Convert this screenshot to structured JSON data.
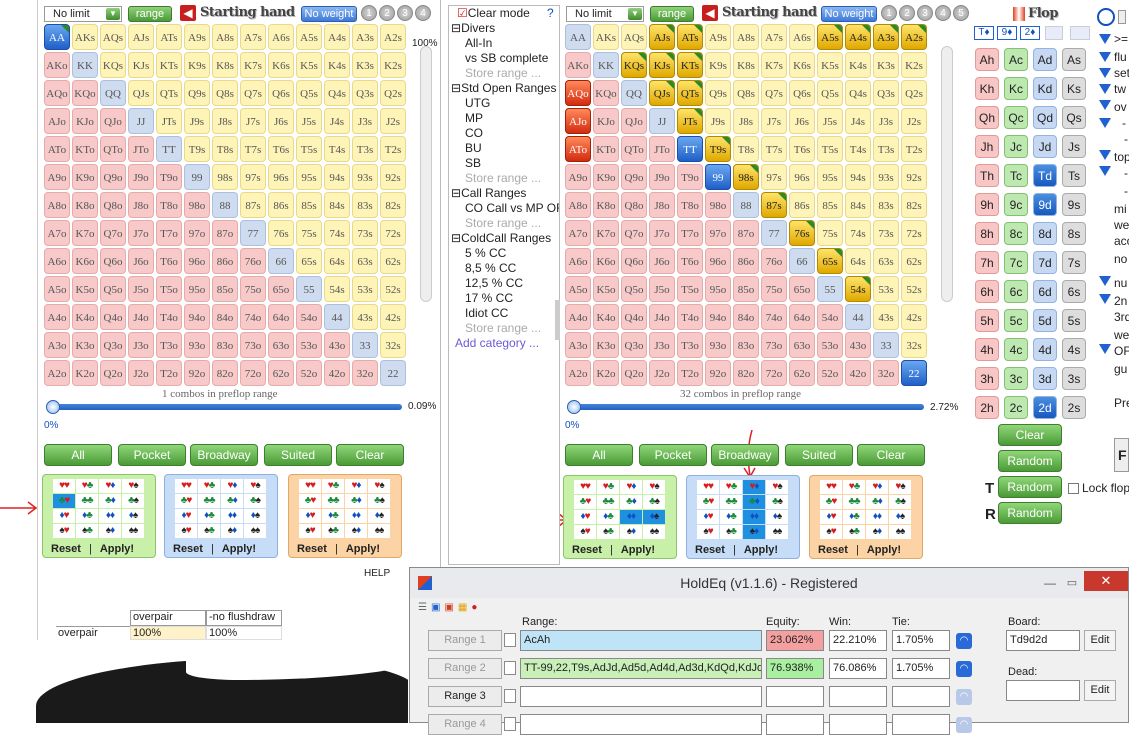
{
  "left_panel": {
    "limit_select": "No limit",
    "range_btn": "range",
    "title": "Starting hand",
    "weight_btn": "No weight",
    "slots": [
      "1",
      "2",
      "3",
      "4"
    ],
    "pct_top": "100%",
    "pct_mid": "0.09%",
    "pct_low": "0%",
    "combos_text": "1 combos in preflop range",
    "buttons": [
      "All",
      "Pocket",
      "Broadway",
      "Suited",
      "Clear"
    ],
    "help": "HELP",
    "selected_hands": [
      "AA"
    ],
    "selected_with_tri": [
      "AA"
    ]
  },
  "tree": {
    "header": "Clear mode",
    "help_q": "?",
    "items": [
      {
        "kind": "cat",
        "text": "Divers"
      },
      {
        "kind": "it",
        "text": "All-In"
      },
      {
        "kind": "it",
        "text": "vs SB complete"
      },
      {
        "kind": "store",
        "text": "Store range ..."
      },
      {
        "kind": "cat",
        "text": "Std Open Ranges"
      },
      {
        "kind": "it",
        "text": "UTG"
      },
      {
        "kind": "it",
        "text": "MP"
      },
      {
        "kind": "it",
        "text": "CO"
      },
      {
        "kind": "it",
        "text": "BU"
      },
      {
        "kind": "it",
        "text": "SB"
      },
      {
        "kind": "store",
        "text": "Store range ..."
      },
      {
        "kind": "cat",
        "text": "Call Ranges"
      },
      {
        "kind": "it",
        "text": "CO Call vs MP OR"
      },
      {
        "kind": "store",
        "text": "Store range ..."
      },
      {
        "kind": "cat",
        "text": "ColdCall Ranges"
      },
      {
        "kind": "it",
        "text": "5 % CC"
      },
      {
        "kind": "it",
        "text": "8,5 % CC"
      },
      {
        "kind": "it",
        "text": "12,5 % CC"
      },
      {
        "kind": "it",
        "text": "17 % CC"
      },
      {
        "kind": "it",
        "text": "Idiot CC"
      },
      {
        "kind": "store",
        "text": "Store range ..."
      },
      {
        "kind": "add",
        "text": "Add category ..."
      }
    ]
  },
  "mid_panel": {
    "limit_select": "No limit",
    "range_btn": "range",
    "title": "Starting hand",
    "weight_btn": "No weight",
    "slots": [
      "1",
      "2",
      "3",
      "4",
      "5"
    ],
    "pct_mid": "2.72%",
    "pct_low": "0%",
    "combos_text": "32 combos in preflop range",
    "buttons": [
      "All",
      "Pocket",
      "Broadway",
      "Suited",
      "Clear"
    ],
    "selected_hands": [
      "AQo",
      "AJo",
      "ATo",
      "AJs",
      "ATs",
      "KQs",
      "KJs",
      "KTs",
      "QJs",
      "QTs",
      "JTs",
      "A5s",
      "A4s",
      "A3s",
      "A2s",
      "TT",
      "T9s",
      "99",
      "98s",
      "87s",
      "76s",
      "65s",
      "54s",
      "22"
    ],
    "selected_with_tri": [
      "A5s",
      "A4s",
      "A3s",
      "A2s",
      "AJs",
      "ATs",
      "KQs",
      "KJs",
      "KTs",
      "QJs",
      "QTs",
      "JTs",
      "98s",
      "87s",
      "76s",
      "65s",
      "54s",
      "T9s"
    ]
  },
  "flop": {
    "title": "Flop",
    "board_cards": [
      "T♦",
      "9♦",
      "2♦"
    ],
    "ranks": [
      "A",
      "K",
      "Q",
      "J",
      "T",
      "9",
      "8",
      "7",
      "6",
      "5",
      "4",
      "3",
      "2"
    ],
    "selected": [
      "Td",
      "9d",
      "2d"
    ],
    "buttons": [
      "Clear",
      "Random",
      "Random",
      "Random"
    ],
    "t_label": "T",
    "r_label": "R",
    "lock_label": "Lock flop"
  },
  "right_notes": [
    ">=",
    "flu",
    "set",
    "tw",
    "ov",
    "-",
    "-",
    "top",
    "-",
    "-",
    "mi",
    "we",
    "acc",
    "no",
    "nu",
    "2n",
    "3rd",
    "we",
    "OF",
    "gu",
    "Pre"
  ],
  "suit_boxes": {
    "reset": "Reset",
    "sep": "|",
    "apply": "Apply!"
  },
  "report": {
    "row1": [
      "overpair",
      "-no flushdraw"
    ],
    "row2": [
      "overpair",
      "100%",
      "100%"
    ]
  },
  "holdeq": {
    "title": "HoldEq (v1.1.6) - Registered",
    "headers": {
      "range": "Range:",
      "equity": "Equity:",
      "win": "Win:",
      "tie": "Tie:",
      "board": "Board:",
      "dead": "Dead:"
    },
    "rows": [
      {
        "label": "Range 1",
        "range": "AcAh",
        "equity": "23.062%",
        "win": "22.210%",
        "tie": "1.705%"
      },
      {
        "label": "Range 2",
        "range": "TT-99,22,T9s,AdJd,Ad5d,Ad4d,Ad3d,KdQd,KdJd,",
        "equity": "76.938%",
        "win": "76.086%",
        "tie": "1.705%"
      },
      {
        "label": "Range 3",
        "range": "",
        "equity": "",
        "win": "",
        "tie": ""
      },
      {
        "label": "Range 4",
        "range": "",
        "equity": "",
        "win": "",
        "tie": ""
      }
    ],
    "board_value": "Td9d2d",
    "dead_value": "",
    "edit": "Edit"
  },
  "colors": {
    "accent_red": "#e02020",
    "equity_red": "#f5a0a0",
    "equity_green": "#a8f0a0"
  }
}
